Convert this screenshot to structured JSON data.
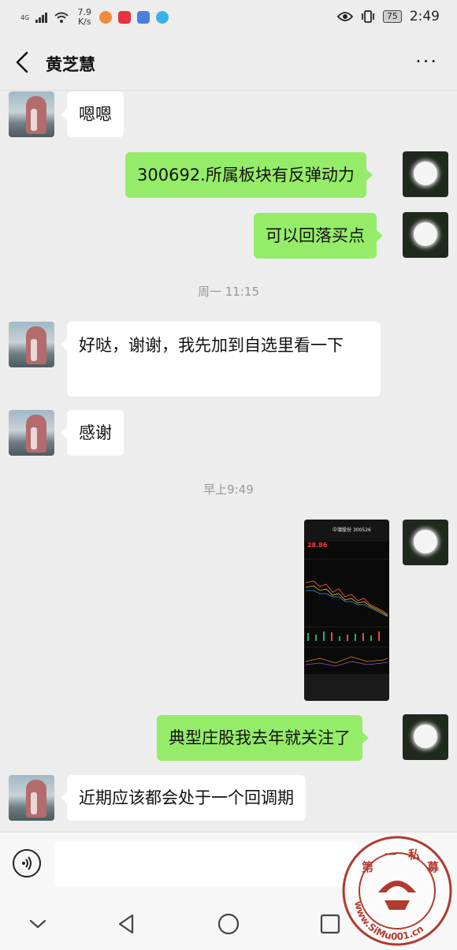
{
  "status_bar": {
    "network": "4G",
    "speed": "7.9 K/s",
    "app_icons": [
      "notification-app-icon",
      "shopping-app-icon",
      "news-app-icon",
      "browser-app-icon"
    ],
    "battery": "75",
    "time": "2:49"
  },
  "header": {
    "title": "黄芝慧",
    "more_label": "···"
  },
  "messages": [
    {
      "side": "left",
      "type": "text",
      "text": "嗯嗯"
    },
    {
      "side": "right",
      "type": "text",
      "text": "300692.所属板块有反弹动力"
    },
    {
      "side": "right",
      "type": "text",
      "text": "可以回落买点"
    },
    {
      "type": "timestamp",
      "text": "周一 11:15"
    },
    {
      "side": "left",
      "type": "text",
      "text": "好哒，谢谢，我先加到自选里看一下"
    },
    {
      "side": "left",
      "type": "text",
      "text": "感谢"
    },
    {
      "type": "timestamp",
      "text": "早上9:49"
    },
    {
      "side": "right",
      "type": "image",
      "stock_name": "中潜股份",
      "stock_code": "300526",
      "price": "28.86"
    },
    {
      "side": "right",
      "type": "text",
      "text": "典型庄股我去年就关注了"
    },
    {
      "side": "left",
      "type": "text",
      "text": "近期应该都会处于一个回调期"
    }
  ],
  "input_bar": {
    "placeholder": ""
  },
  "watermark": {
    "text": "第一私募",
    "url": "www.SiMu001.cn"
  },
  "colors": {
    "background": "#ededed",
    "bubble_sent": "#95ec69",
    "bubble_received": "#ffffff",
    "timestamp": "#999999",
    "watermark": "#c0392b"
  }
}
